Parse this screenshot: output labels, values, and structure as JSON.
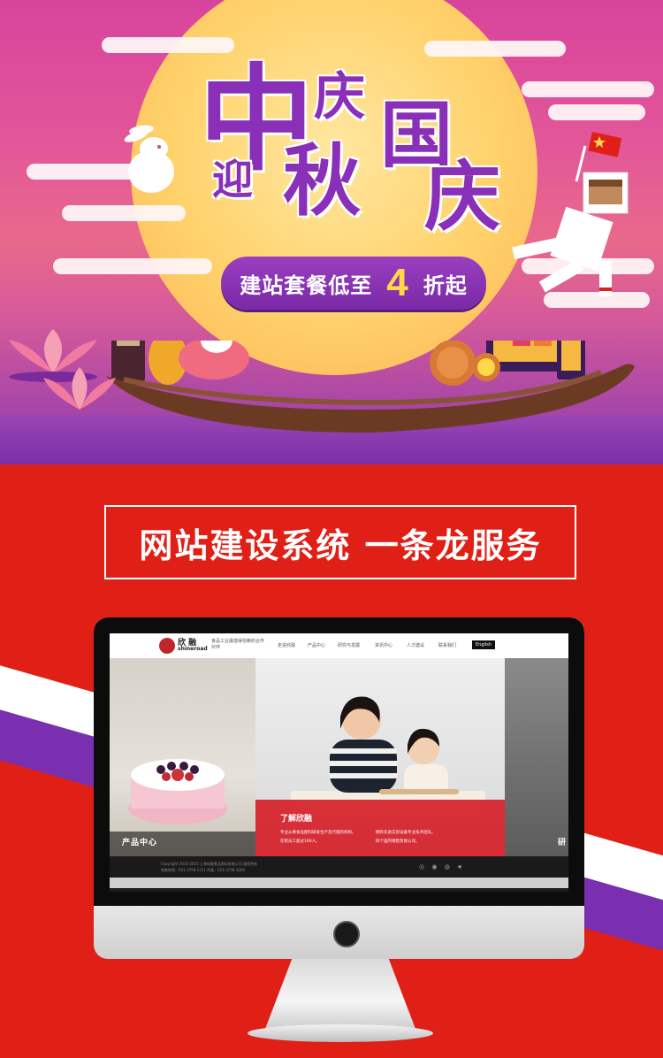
{
  "banner": {
    "title_chars": [
      "中",
      "庆",
      "迎",
      "秋",
      "国",
      "庆"
    ],
    "promo_prefix": "建站套餐低至",
    "promo_number": "4",
    "promo_suffix": "折起",
    "flag_icon": "china-flag-icon"
  },
  "slogan": "网站建设系统  一条龙服务",
  "screen": {
    "logo_cn": "欣 融",
    "logo_en": "shineroad",
    "logo_tagline": "食品工业最值得信赖的合作伙伴",
    "nav": [
      "走进欣融",
      "产品中心",
      "研究与发展",
      "资讯中心",
      "人才建设",
      "联系我们"
    ],
    "nav_lang": "English",
    "left_panel_label": "产品中心",
    "card_title": "了解欣融",
    "card_lines": [
      "专业从事食品配料研发生产及代理的机构。",
      "拥有先进实验设备专业技术团队。",
      "在职员工超过190人。",
      "四个国内销售贸易公司。"
    ],
    "footer_lines": [
      "Copyright 2012-2015 上海欣融食品原料有限公司 版权所有",
      "销售热线：021-3758-1111  传真：021-3758-1000"
    ],
    "footer_icons": "◎ ◉ ◍ ★",
    "right_panel_label": "研"
  },
  "colors": {
    "red": "#e01f17",
    "purple": "#7a2fb0",
    "title_purple": "#8a2fb8",
    "promo_yellow": "#ffd84a"
  }
}
